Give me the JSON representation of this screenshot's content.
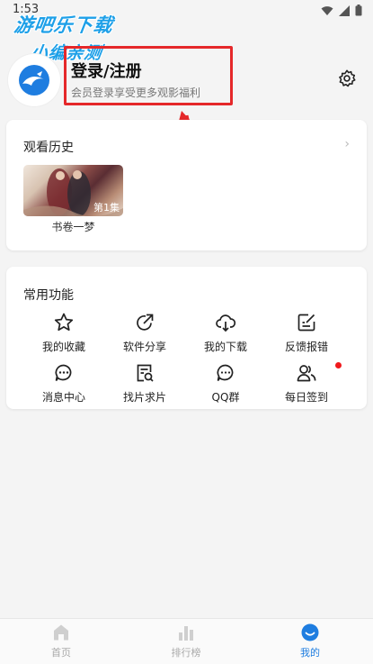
{
  "status": {
    "time": "1:53"
  },
  "watermark": {
    "line1": "游吧乐下载",
    "line2": "小编亲测"
  },
  "profile": {
    "title": "登录/注册",
    "subtitle": "会员登录享受更多观影福利"
  },
  "history": {
    "title": "观看历史",
    "items": [
      {
        "title": "书卷一梦",
        "episode": "第1集"
      }
    ]
  },
  "features": {
    "title": "常用功能",
    "items": [
      {
        "label": "我的收藏",
        "icon": "star-icon"
      },
      {
        "label": "软件分享",
        "icon": "share-icon"
      },
      {
        "label": "我的下载",
        "icon": "cloud-download-icon"
      },
      {
        "label": "反馈报错",
        "icon": "feedback-icon"
      },
      {
        "label": "消息中心",
        "icon": "message-icon"
      },
      {
        "label": "找片求片",
        "icon": "search-doc-icon"
      },
      {
        "label": "QQ群",
        "icon": "chat-icon"
      },
      {
        "label": "每日签到",
        "icon": "people-icon"
      }
    ]
  },
  "tabs": [
    {
      "label": "首页",
      "icon": "home-icon",
      "active": false
    },
    {
      "label": "排行榜",
      "icon": "ranking-icon",
      "active": false
    },
    {
      "label": "我的",
      "icon": "profile-icon",
      "active": true
    }
  ],
  "colors": {
    "accent": "#1e7de0",
    "highlight": "#e5282a",
    "dot": "#f0191c"
  }
}
